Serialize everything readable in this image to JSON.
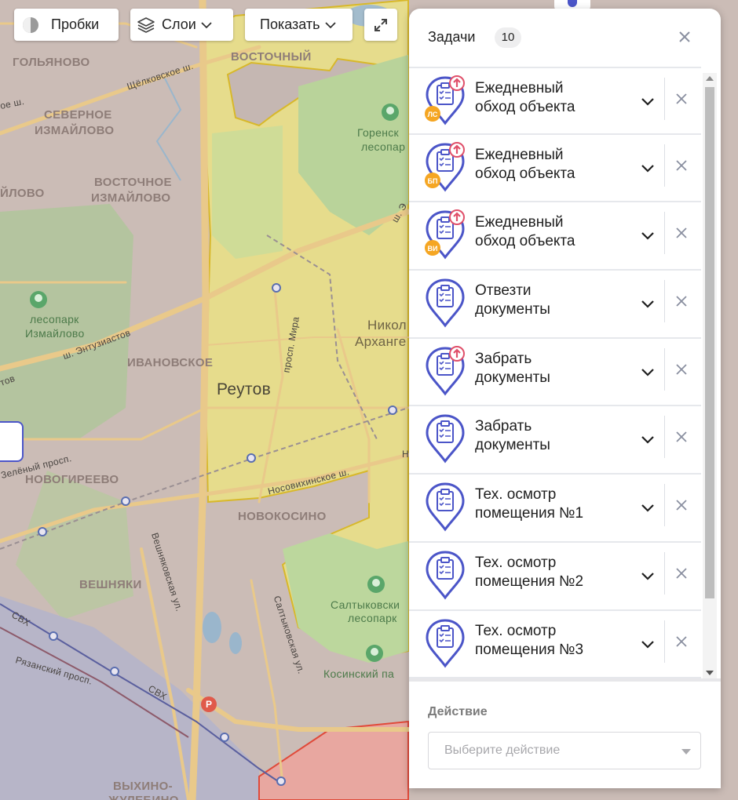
{
  "toolbar": {
    "traffic_label": "Пробки",
    "layers_label": "Слои",
    "show_label": "Показать",
    "fullscreen_icon": "expand-icon"
  },
  "map": {
    "labels": {
      "golyanovo": "ГОЛЬЯНОВО",
      "vostochny": "ВОСТОЧНЫЙ",
      "severnoe_izmaylovo_1": "СЕВЕРНОЕ",
      "severnoe_izmaylovo_2": "ИЗМАЙЛОВО",
      "vostochnoe_izmaylovo_1": "ВОСТОЧНОЕ",
      "vostochnoe_izmaylovo_2": "ИЗМАЙЛОВО",
      "izmaylovo_partial": "ЙЛОВО",
      "ivanovskoe": "ИВАНОВСКОЕ",
      "novogireevo": "НОВОГИРЕЕВО",
      "novokosino": "НОВОКОСИНО",
      "veshnyaki": "ВЕШНЯКИ",
      "vykhino_1": "ВЫХИНО-",
      "vykhino_2": "ЖУЛЕБИНО",
      "reutov": "Реутов",
      "nikol_1": "Никол",
      "nikol_2": "Архангe",
      "park_izmaylovo_1": "лесопарк",
      "park_izmaylovo_2": "Измайлово",
      "park_gorenskiy_1": "Горенск",
      "park_gorenskiy_2": "лесопар",
      "park_saltykovskiy_1": "Салтыковски",
      "park_saltykovskiy_2": "лесопарк",
      "park_kosinskiy": "Косинский па",
      "street_schelkovskoe": "Щёлковское ш.",
      "street_sh_1": "ое ш.",
      "street_entuziastov": "ш. Энтузиастов",
      "street_tov": "тов",
      "street_zeleny": "Зелёный просп.",
      "street_mira": "просп. Мира",
      "street_nosovikhinskoe": "Носовихинское ш.",
      "street_veshnyakovskaya": "Вешняковская ул.",
      "street_saltykovskaya": "Салтыковская ул.",
      "street_ryazansky": "Рязанский просп.",
      "street_svh_1": "СВХ",
      "street_svh_2": "СВХ",
      "street_n": "Н",
      "street_sh_3": "ш. Э",
      "parking": "P"
    }
  },
  "panel": {
    "title": "Задачи",
    "count": "10",
    "tasks": [
      {
        "line1": "Ежедневный",
        "line2": "обход объекта",
        "badge": "ЛС",
        "badge_color": "#f5a623",
        "alert": true
      },
      {
        "line1": "Ежедневный",
        "line2": "обход объекта",
        "badge": "БП",
        "badge_color": "#f5a623",
        "alert": true
      },
      {
        "line1": "Ежедневный",
        "line2": "обход объекта",
        "badge": "ВИ",
        "badge_color": "#f5a623",
        "alert": true
      },
      {
        "line1": "Отвезти",
        "line2": "документы",
        "badge": "",
        "badge_color": "",
        "alert": false
      },
      {
        "line1": "Забрать",
        "line2": "документы",
        "badge": "",
        "badge_color": "",
        "alert": true
      },
      {
        "line1": "Забрать",
        "line2": "документы",
        "badge": "",
        "badge_color": "",
        "alert": false
      },
      {
        "line1": "Тех. осмотр",
        "line2": "помещения №1",
        "badge": "",
        "badge_color": "",
        "alert": false
      },
      {
        "line1": "Тех. осмотр",
        "line2": "помещения №2",
        "badge": "",
        "badge_color": "",
        "alert": false
      },
      {
        "line1": "Тех. осмотр",
        "line2": "помещения №3",
        "badge": "",
        "badge_color": "",
        "alert": false
      }
    ],
    "action": {
      "label": "Действие",
      "placeholder": "Выберите действие"
    }
  },
  "colors": {
    "accent": "#4b55c8",
    "alert": "#e0506a",
    "badge": "#f5a623",
    "reutov_fill": "#e9e08a",
    "park_fill": "#bcd59a"
  }
}
